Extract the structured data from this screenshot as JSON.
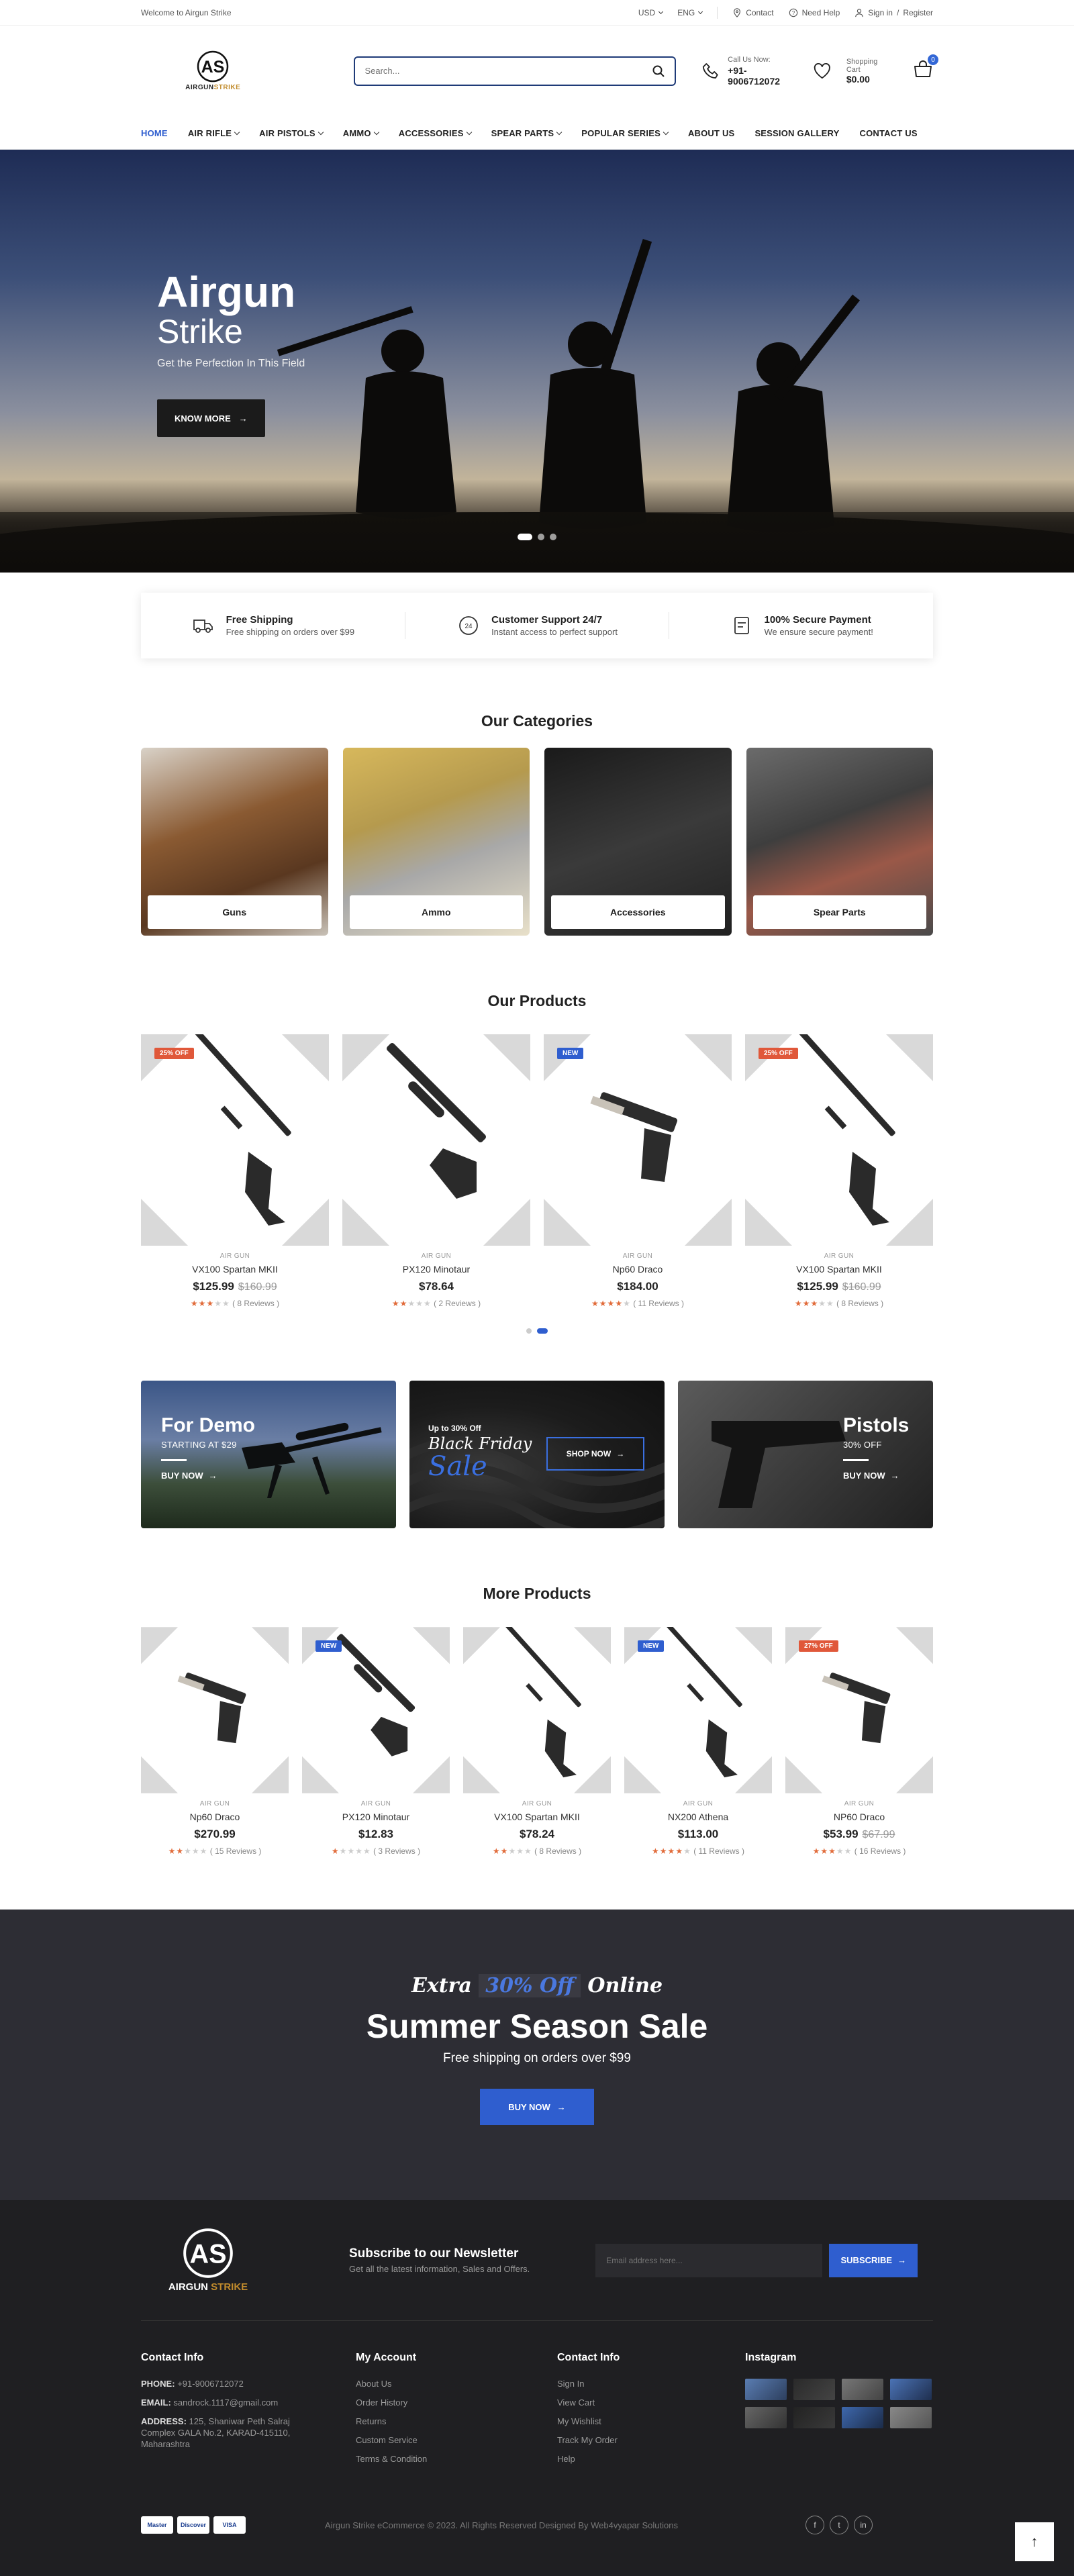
{
  "topbar": {
    "welcome": "Welcome to Airgun Strike",
    "currency": "USD",
    "language": "ENG",
    "contact": "Contact",
    "help": "Need Help",
    "signin": "Sign in",
    "slash": "/",
    "register": "Register"
  },
  "header": {
    "logo_name_1": "AIRGUN",
    "logo_name_2": "STRIKE",
    "search_placeholder": "Search...",
    "call_label": "Call Us Now:",
    "call_number": "+91-9006712072",
    "cart_label": "Shopping Cart",
    "cart_amount": "$0.00",
    "cart_count": "0"
  },
  "nav": [
    {
      "label": "HOME",
      "active": true,
      "dropdown": false
    },
    {
      "label": "AIR RIFLE",
      "active": false,
      "dropdown": true
    },
    {
      "label": "AIR PISTOLS",
      "active": false,
      "dropdown": true
    },
    {
      "label": "AMMO",
      "active": false,
      "dropdown": true
    },
    {
      "label": "ACCESSORIES",
      "active": false,
      "dropdown": true
    },
    {
      "label": "SPEAR PARTS",
      "active": false,
      "dropdown": true
    },
    {
      "label": "POPULAR SERIES",
      "active": false,
      "dropdown": true
    },
    {
      "label": "ABOUT US",
      "active": false,
      "dropdown": false
    },
    {
      "label": "SESSION GALLERY",
      "active": false,
      "dropdown": false
    },
    {
      "label": "CONTACT US",
      "active": false,
      "dropdown": false
    }
  ],
  "hero": {
    "title": "Airgun",
    "subtitle": "Strike",
    "tagline": "Get the Perfection In This Field",
    "button": "KNOW MORE"
  },
  "features": [
    {
      "title": "Free Shipping",
      "desc": "Free shipping on orders over $99",
      "icon": "truck-icon"
    },
    {
      "title": "Customer Support 24/7",
      "desc": "Instant access to perfect support",
      "icon": "support-24-icon"
    },
    {
      "title": "100% Secure Payment",
      "desc": "We ensure secure payment!",
      "icon": "secure-payment-icon"
    }
  ],
  "categories": {
    "title": "Our Categories",
    "items": [
      "Guns",
      "Ammo",
      "Accessories",
      "Spear Parts"
    ]
  },
  "products": {
    "title": "Our Products",
    "items": [
      {
        "badge": "25% OFF",
        "badge_type": "sale",
        "cat": "AIR GUN",
        "name": "VX100 Spartan MKII",
        "price": "$125.99",
        "old": "$160.99",
        "stars": 3,
        "reviews": "( 8 Reviews )"
      },
      {
        "badge": "",
        "badge_type": "",
        "cat": "AIR GUN",
        "name": "PX120 Minotaur",
        "price": "$78.64",
        "old": "",
        "stars": 2,
        "reviews": "( 2 Reviews )"
      },
      {
        "badge": "NEW",
        "badge_type": "new",
        "cat": "AIR GUN",
        "name": "Np60 Draco",
        "price": "$184.00",
        "old": "",
        "stars": 4,
        "reviews": "( 11 Reviews )"
      },
      {
        "badge": "25% OFF",
        "badge_type": "sale",
        "cat": "AIR GUN",
        "name": "VX100 Spartan MKII",
        "price": "$125.99",
        "old": "$160.99",
        "stars": 3,
        "reviews": "( 8 Reviews )"
      }
    ]
  },
  "banners": {
    "demo_title": "For Demo",
    "demo_sub": "STARTING AT $29",
    "demo_link": "BUY NOW",
    "bf_small": "Up to 30% Off",
    "bf_title": "Black Friday",
    "bf_sale": "Sale",
    "bf_btn": "SHOP NOW",
    "pistol_title": "Pistols",
    "pistol_sub": "30% OFF",
    "pistol_link": "BUY NOW"
  },
  "more_products": {
    "title": "More Products",
    "items": [
      {
        "badge": "",
        "badge_type": "",
        "cat": "AIR GUN",
        "name": "Np60 Draco",
        "price": "$270.99",
        "old": "",
        "stars": 2,
        "reviews": "( 15 Reviews )"
      },
      {
        "badge": "NEW",
        "badge_type": "new",
        "cat": "AIR GUN",
        "name": "PX120 Minotaur",
        "price": "$12.83",
        "old": "",
        "stars": 1,
        "reviews": "( 3 Reviews )"
      },
      {
        "badge": "",
        "badge_type": "",
        "cat": "AIR GUN",
        "name": "VX100 Spartan MKII",
        "price": "$78.24",
        "old": "",
        "stars": 2,
        "reviews": "( 8 Reviews )"
      },
      {
        "badge": "NEW",
        "badge_type": "new",
        "cat": "AIR GUN",
        "name": "NX200 Athena",
        "price": "$113.00",
        "old": "",
        "stars": 4,
        "reviews": "( 11 Reviews )"
      },
      {
        "badge": "27% OFF",
        "badge_type": "sale",
        "cat": "AIR GUN",
        "name": "NP60 Draco",
        "price": "$53.99",
        "old": "$67.99",
        "stars": 3,
        "reviews": "( 16 Reviews )"
      }
    ]
  },
  "promo": {
    "extra_1": "Extra",
    "extra_hl": "30% Off",
    "extra_2": "Online",
    "title": "Summer Season Sale",
    "sub": "Free shipping on orders over $99",
    "button": "BUY NOW"
  },
  "footer": {
    "logo_name_1": "AIRGUN",
    "logo_name_2": "STRIKE",
    "nl_title": "Subscribe to our Newsletter",
    "nl_desc": "Get all the latest information, Sales and Offers.",
    "nl_placeholder": "Email address here...",
    "nl_button": "SUBSCRIBE",
    "col1_title": "Contact Info",
    "phone_label": "PHONE:",
    "phone": "+91-9006712072",
    "email_label": "EMAIL:",
    "email": "sandrock.1117@gmail.com",
    "address_label": "ADDRESS:",
    "address": "125, Shaniwar Peth Salraj Complex GALA No.2, KARAD-415110, Maharashtra",
    "col2_title": "My Account",
    "col2_links": [
      "About Us",
      "Order History",
      "Returns",
      "Custom Service",
      "Terms & Condition"
    ],
    "col3_title": "Contact Info",
    "col3_links": [
      "Sign In",
      "View Cart",
      "My Wishlist",
      "Track My Order",
      "Help"
    ],
    "col4_title": "Instagram",
    "payments": [
      "Master",
      "Discover",
      "VISA"
    ],
    "copyright": "Airgun Strike eCommerce © 2023. All Rights Reserved Designed By Web4vyapar Solutions",
    "social": [
      "f",
      "t",
      "in"
    ]
  }
}
